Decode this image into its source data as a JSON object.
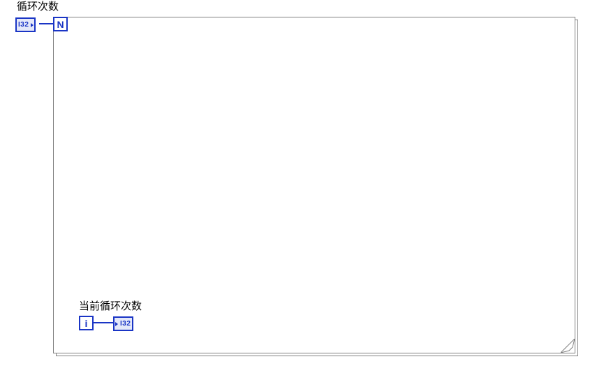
{
  "labels": {
    "loop_count": "循环次数",
    "current_iteration": "当前循环次数"
  },
  "datatypes": {
    "i32": "I32"
  },
  "loop_terminals": {
    "count_terminal": "N",
    "iteration_terminal": "i"
  }
}
